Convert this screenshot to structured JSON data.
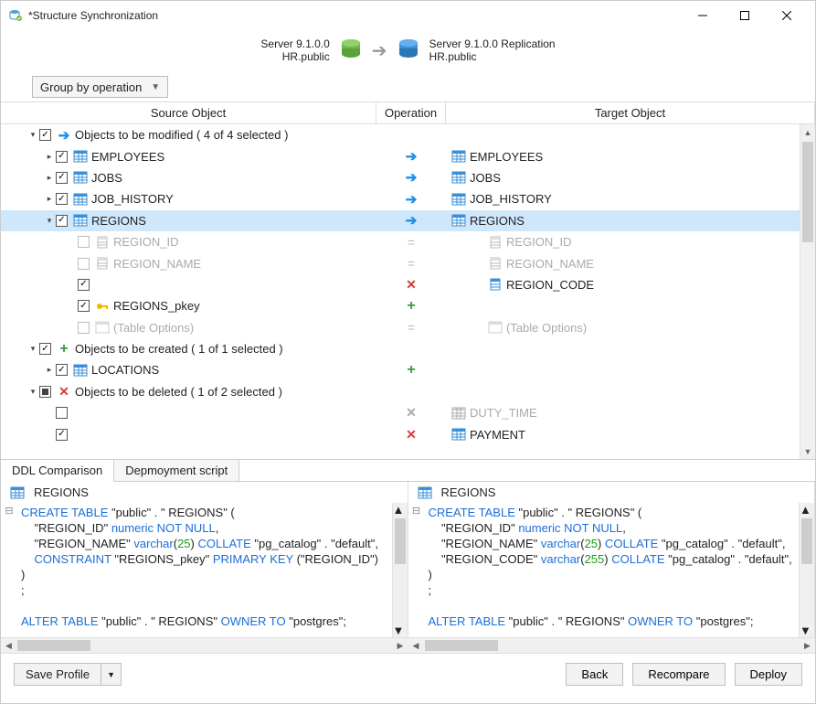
{
  "window": {
    "title": "*Structure Synchronization"
  },
  "sync": {
    "source": {
      "line1": "Server 9.1.0.0",
      "line2": "HR.public"
    },
    "target": {
      "line1": "Server 9.1.0.0 Replication",
      "line2": "HR.public"
    }
  },
  "toolbar": {
    "group_by": "Group by operation"
  },
  "columns": {
    "source": "Source Object",
    "op": "Operation",
    "target": "Target Object"
  },
  "groups": {
    "modified": {
      "label": "Objects to be modified ( 4 of 4 selected )"
    },
    "created": {
      "label": "Objects to be created ( 1 of 1 selected )"
    },
    "deleted": {
      "label": "Objects to be deleted ( 1 of 2 selected )"
    }
  },
  "rows": {
    "employees": {
      "src": "EMPLOYEES",
      "tgt": "EMPLOYEES"
    },
    "jobs": {
      "src": "JOBS",
      "tgt": "JOBS"
    },
    "job_history": {
      "src": "JOB_HISTORY",
      "tgt": "JOB_HISTORY"
    },
    "regions": {
      "src": "REGIONS",
      "tgt": "REGIONS"
    },
    "region_id": {
      "src": "REGION_ID",
      "tgt": "REGION_ID"
    },
    "region_name": {
      "src": "REGION_NAME",
      "tgt": "REGION_NAME"
    },
    "region_code": {
      "src": "",
      "tgt": "REGION_CODE"
    },
    "regions_pkey": {
      "src": "REGIONS_pkey",
      "tgt": ""
    },
    "table_opts": {
      "src": "(Table Options)",
      "tgt": "(Table Options)"
    },
    "locations": {
      "src": "LOCATIONS",
      "tgt": ""
    },
    "duty_time": {
      "src": "",
      "tgt": "DUTY_TIME"
    },
    "payment": {
      "src": "",
      "tgt": "PAYMENT"
    }
  },
  "tabs": {
    "ddl": "DDL Comparison",
    "deploy": "Depmoyment script"
  },
  "ddl": {
    "left": {
      "title": "REGIONS",
      "lines": [
        {
          "t": "CREATE TABLE ",
          "k": true
        },
        {
          "t": "\"public\" . \" REGIONS\" (\n"
        },
        {
          "t": "    \"REGION_ID\" "
        },
        {
          "t": "numeric NOT NULL",
          "k": true
        },
        {
          "t": ",\n"
        },
        {
          "t": "    \"REGION_NAME\" "
        },
        {
          "t": "varchar",
          "k": true
        },
        {
          "t": "("
        },
        {
          "t": "25",
          "n": true
        },
        {
          "t": ")"
        },
        {
          "t": " COLLATE ",
          "k": true
        },
        {
          "t": "\"pg_catalog\" . \"default\",\n"
        },
        {
          "t": "    "
        },
        {
          "t": "CONSTRAINT ",
          "k": true
        },
        {
          "t": "\"REGIONS_pkey\""
        },
        {
          "t": " PRIMARY KEY ",
          "k": true
        },
        {
          "t": "(\"REGION_ID\")\n"
        },
        {
          "t": ")\n"
        },
        {
          "t": ";\n"
        },
        {
          "t": "\n"
        },
        {
          "t": "ALTER TABLE ",
          "k": true
        },
        {
          "t": "\"public\" . \" REGIONS\""
        },
        {
          "t": " OWNER TO ",
          "k": true
        },
        {
          "t": "\"postgres\";"
        }
      ]
    },
    "right": {
      "title": "REGIONS",
      "lines": [
        {
          "t": "CREATE TABLE ",
          "k": true
        },
        {
          "t": "\"public\" . \" REGIONS\" (\n"
        },
        {
          "t": "    \"REGION_ID\" "
        },
        {
          "t": "numeric NOT NULL",
          "k": true
        },
        {
          "t": ",\n"
        },
        {
          "t": "    \"REGION_NAME\" "
        },
        {
          "t": "varchar",
          "k": true
        },
        {
          "t": "("
        },
        {
          "t": "25",
          "n": true
        },
        {
          "t": ")"
        },
        {
          "t": " COLLATE ",
          "k": true
        },
        {
          "t": "\"pg_catalog\" . \"default\",\n"
        },
        {
          "t": "    \"REGION_CODE\" "
        },
        {
          "t": "varchar",
          "k": true
        },
        {
          "t": "("
        },
        {
          "t": "255",
          "n": true
        },
        {
          "t": ")"
        },
        {
          "t": " COLLATE ",
          "k": true
        },
        {
          "t": "\"pg_catalog\" . \"default\",\n"
        },
        {
          "t": ")\n"
        },
        {
          "t": ";\n"
        },
        {
          "t": "\n"
        },
        {
          "t": "ALTER TABLE ",
          "k": true
        },
        {
          "t": "\"public\" . \" REGIONS\""
        },
        {
          "t": " OWNER TO ",
          "k": true
        },
        {
          "t": "\"postgres\";"
        }
      ]
    }
  },
  "footer": {
    "save_profile": "Save Profile",
    "back": "Back",
    "recompare": "Recompare",
    "deploy": "Deploy"
  }
}
